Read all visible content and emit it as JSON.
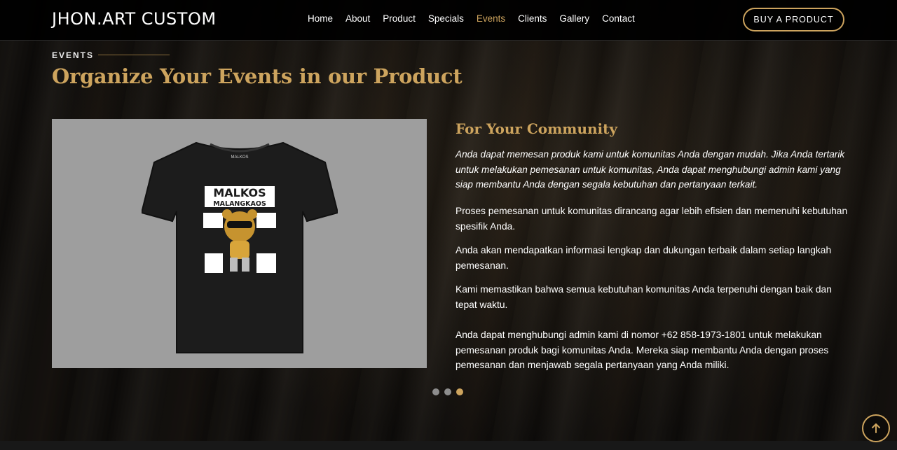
{
  "header": {
    "logo": "JHON.ART CUSTOM",
    "nav": [
      "Home",
      "About",
      "Product",
      "Specials",
      "Events",
      "Clients",
      "Gallery",
      "Contact"
    ],
    "active_nav": "Events",
    "buy_button": "BUY A PRODUCT"
  },
  "section": {
    "label": "EVENTS",
    "title": "Organize Your Events in our Product"
  },
  "product_image": {
    "brand_small": "MALKOS",
    "print_line1": "MALKOS",
    "print_line2": "MALANGKAOS"
  },
  "content": {
    "subtitle": "For Your Community",
    "intro": "Anda dapat memesan produk kami untuk komunitas Anda dengan mudah. Jika Anda tertarik untuk melakukan pemesanan untuk komunitas, Anda dapat menghubungi admin kami yang siap membantu Anda dengan segala kebutuhan dan pertanyaan terkait.",
    "points": [
      " Proses pemesanan untuk komunitas dirancang agar lebih efisien dan memenuhi kebutuhan spesifik Anda.",
      " Anda akan mendapatkan informasi lengkap dan dukungan terbaik dalam setiap langkah pemesanan.",
      " Kami memastikan bahwa semua kebutuhan komunitas Anda terpenuhi dengan baik dan tepat waktu."
    ],
    "contact": "Anda dapat menghubungi admin kami di nomor +62 858-1973-1801 untuk melakukan pemesanan produk bagi komunitas Anda. Mereka siap membantu Anda dengan proses pemesanan dan menjawab segala pertanyaan yang Anda miliki."
  },
  "carousel": {
    "count": 3,
    "active": 3
  },
  "colors": {
    "accent": "#cda45e",
    "header_bg": "#000000",
    "panel_bg": "#9e9e9e"
  },
  "icons": {
    "back_to_top": "arrow-up-icon"
  }
}
